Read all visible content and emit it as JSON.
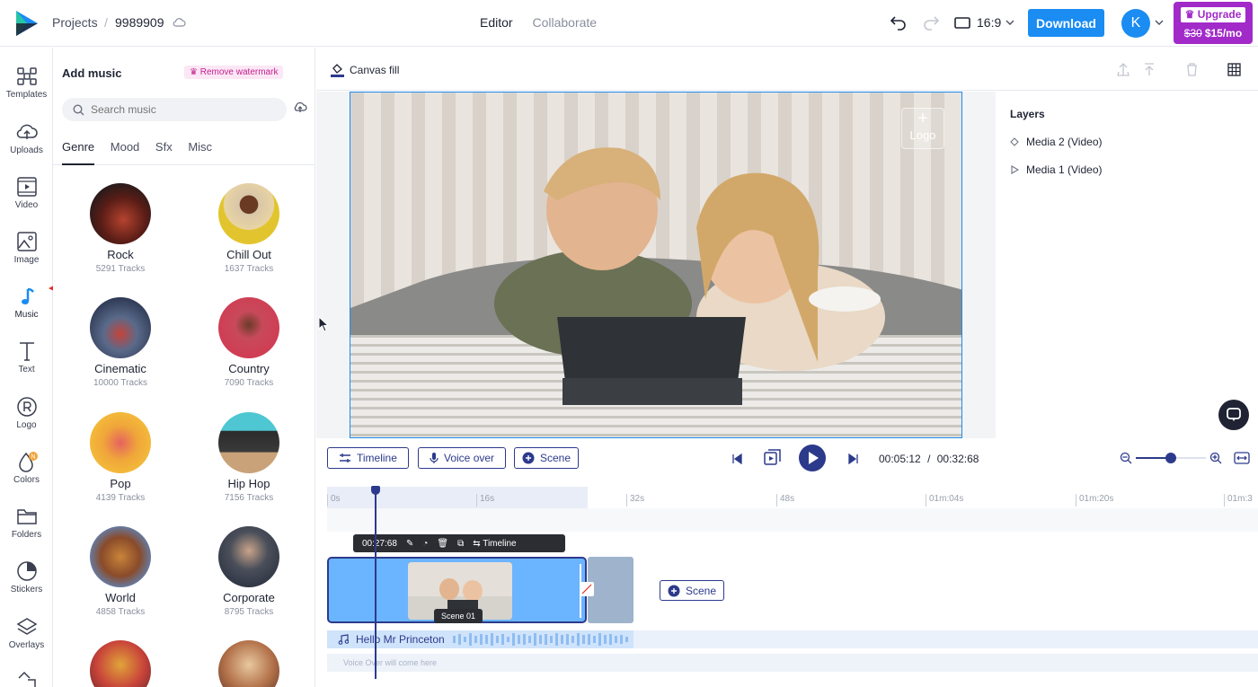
{
  "topbar": {
    "breadcrumb_projects": "Projects",
    "breadcrumb_sep": "/",
    "project_name": "9989909",
    "tab_editor": "Editor",
    "tab_collaborate": "Collaborate",
    "aspect_ratio": "16:9",
    "download_label": "Download",
    "avatar_initial": "K",
    "upgrade_label": "Upgrade",
    "upgrade_old_price": "$30",
    "upgrade_new_price": "$15/mo"
  },
  "leftnav": {
    "items": [
      {
        "label": "Templates"
      },
      {
        "label": "Uploads"
      },
      {
        "label": "Video"
      },
      {
        "label": "Image"
      },
      {
        "label": "Music"
      },
      {
        "label": "Text"
      },
      {
        "label": "Logo"
      },
      {
        "label": "Colors"
      },
      {
        "label": "Folders"
      },
      {
        "label": "Stickers"
      },
      {
        "label": "Overlays"
      }
    ],
    "colors_badge": "N"
  },
  "panel": {
    "title": "Add music",
    "watermark_badge": "Remove watermark",
    "search_placeholder": "Search music",
    "categories": [
      "Genre",
      "Mood",
      "Sfx",
      "Misc"
    ],
    "genres": [
      {
        "name": "Rock",
        "count": "5291 Tracks"
      },
      {
        "name": "Chill Out",
        "count": "1637 Tracks"
      },
      {
        "name": "Cinematic",
        "count": "10000 Tracks"
      },
      {
        "name": "Country",
        "count": "7090 Tracks"
      },
      {
        "name": "Pop",
        "count": "4139 Tracks"
      },
      {
        "name": "Hip Hop",
        "count": "7156 Tracks"
      },
      {
        "name": "World",
        "count": "4858 Tracks"
      },
      {
        "name": "Corporate",
        "count": "8795 Tracks"
      }
    ]
  },
  "canvas": {
    "canvas_fill_label": "Canvas fill",
    "logo_placeholder": "Logo"
  },
  "layers": {
    "title": "Layers",
    "items": [
      {
        "label": "Media 2 (Video)"
      },
      {
        "label": "Media 1 (Video)"
      }
    ]
  },
  "timeline": {
    "timeline_btn": "Timeline",
    "voiceover_btn": "Voice over",
    "scene_btn": "Scene",
    "current_time": "00:05:12",
    "time_sep": "/",
    "total_time": "00:32:68",
    "zoom_level": 0.5,
    "ruler_ticks": [
      "0s",
      "16s",
      "32s",
      "48s",
      "01m:04s",
      "01m:20s",
      "01m:3"
    ],
    "scene_duration": "00:27:68",
    "scene_tools_timeline": "Timeline",
    "scene_label": "Scene 01",
    "add_scene_label": "Scene",
    "music_track_label": "Hello Mr Princeton",
    "voice_track_placeholder": "Voice Over will come here"
  },
  "colors": {
    "accent": "#1a8cf2",
    "navy": "#2c3a8c",
    "upgrade_purple": "#a12ac9",
    "annotation_arrow": "#e8291f"
  }
}
